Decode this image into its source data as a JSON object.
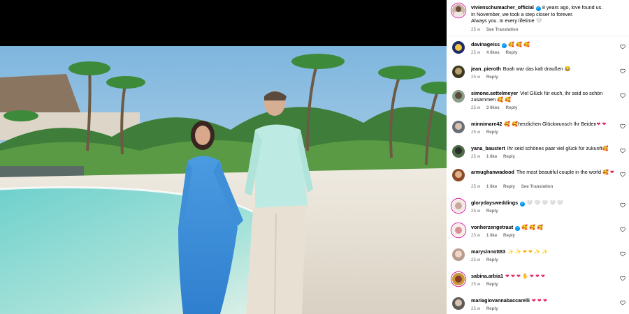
{
  "caption": {
    "username": "vivienschumacher_official",
    "line1": "8 years ago, love found us.",
    "line2": "In November, we took a step closer to forever.",
    "line3": "Always you. In every lifetime",
    "line3_emoji": "🤍",
    "time": "25 w",
    "see_translation": "See Translation"
  },
  "comments": [
    {
      "username": "davinageiss",
      "verified": true,
      "text": "",
      "emoji": "🥰 🥰 🥰",
      "time": "25 w",
      "likes": "4 likes",
      "reply": "Reply"
    },
    {
      "username": "jean_pieroth",
      "verified": false,
      "text": "Boah war das kalt draußen",
      "emoji": "😂",
      "time": "25 w",
      "likes": "",
      "reply": "Reply"
    },
    {
      "username": "simone.settelmeyer",
      "verified": false,
      "text": "Viel Glück für euch, ihr seid so schön zusammen",
      "emoji": "🥰 🥰",
      "time": "25 w",
      "likes": "3 likes",
      "reply": "Reply"
    },
    {
      "username": "minnimare42",
      "verified": false,
      "text": "herzlichen Glückwunsch Ihr Beiden",
      "emoji": "❤ ❤",
      "emoji_pre": "🥰 🥰",
      "time": "25 w",
      "likes": "",
      "reply": "Reply"
    },
    {
      "username": "yana_baustert",
      "verified": false,
      "text": "Ihr seid schönes paar viel glück für zukunft",
      "emoji": "🥰",
      "time": "25 w",
      "likes": "1 like",
      "reply": "Reply"
    },
    {
      "username": "armughanwadood",
      "verified": false,
      "text": "The most beautiful couple in the world",
      "emoji": "🥰 ❤",
      "time": "25 w",
      "likes": "1 like",
      "reply": "Reply",
      "see_translation": "See Translation"
    },
    {
      "username": "glorydaysweddings",
      "verified": true,
      "text": "",
      "emoji": "🤍 🤍 🤍 🤍 🤍",
      "time": "25 w",
      "likes": "",
      "reply": "Reply"
    },
    {
      "username": "vonherzengetraut",
      "verified": true,
      "text": "",
      "emoji": "🥰 🥰 🥰",
      "time": "25 w",
      "likes": "1 like",
      "reply": "Reply"
    },
    {
      "username": "marysinnott83",
      "verified": false,
      "text": "",
      "emoji": "✨ ✨ ❤ ❤ ✨ ✨",
      "time": "25 w",
      "likes": "",
      "reply": "Reply"
    },
    {
      "username": "sabina.arbia1",
      "verified": false,
      "text": "",
      "emoji": "❤ ❤ ❤ ✋ ❤ ❤ ❤",
      "time": "25 w",
      "likes": "",
      "reply": "Reply"
    },
    {
      "username": "mariagiovannabaccarelli",
      "verified": false,
      "text": "",
      "emoji": "❤ ❤ ❤",
      "time": "25 w",
      "likes": "",
      "reply": "Reply"
    }
  ],
  "colors": {
    "accent_blue": "#0095f6",
    "meta_gray": "#737373",
    "heart_red": "#e0245e"
  },
  "icons": {
    "like": "heart-outline-icon",
    "verified": "verified-badge-icon"
  }
}
